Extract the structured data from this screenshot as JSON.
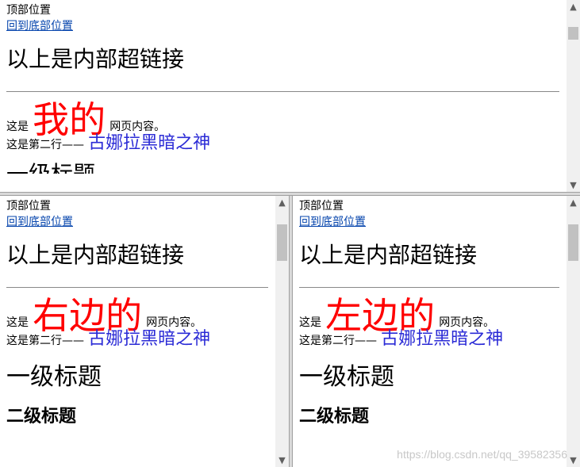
{
  "frames": {
    "top": {
      "top_anchor": "顶部位置",
      "back_link": "回到底部位置",
      "heading": "以上是内部超链接",
      "line1_prefix": "这是",
      "line1_highlight": "我的",
      "line1_suffix": "网页内容。",
      "line2_prefix": "这是第二行——",
      "line2_blue": "古娜拉黑暗之神",
      "partial_heading": "一级标题"
    },
    "left": {
      "top_anchor": "顶部位置",
      "back_link": "回到底部位置",
      "heading": "以上是内部超链接",
      "line1_prefix": "这是",
      "line1_highlight": "右边的",
      "line1_suffix": "网页内容。",
      "line2_prefix": "这是第二行——",
      "line2_blue": "古娜拉黑暗之神",
      "h1": "一级标题",
      "h2": "二级标题"
    },
    "right": {
      "top_anchor": "顶部位置",
      "back_link": "回到底部位置",
      "heading": "以上是内部超链接",
      "line1_prefix": "这是",
      "line1_highlight": "左边的",
      "line1_suffix": "网页内容。",
      "line2_prefix": "这是第二行——",
      "line2_blue": "古娜拉黑暗之神",
      "h1": "一级标题",
      "h2": "二级标题"
    }
  },
  "scroll_icons": {
    "up": "▲",
    "down": "▼"
  },
  "watermark": "https://blog.csdn.net/qq_39582356",
  "colors": {
    "highlight": "#ff0000",
    "blue_text": "#2b2bd6",
    "link": "#0645ad"
  }
}
